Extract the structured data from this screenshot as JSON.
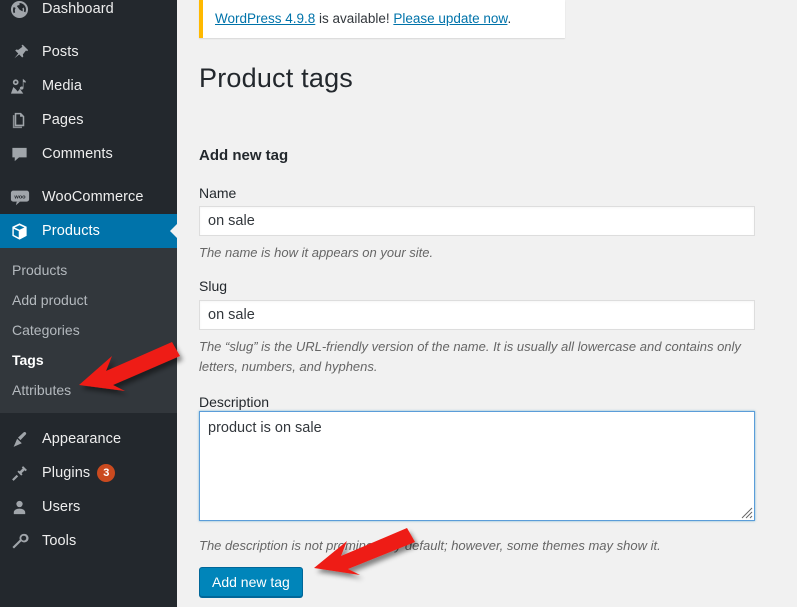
{
  "sidebar": {
    "items": [
      {
        "label": "Dashboard",
        "icon": "dashboard-icon",
        "name": "dashboard"
      },
      {
        "label": "Posts",
        "icon": "pin-icon",
        "name": "posts"
      },
      {
        "label": "Media",
        "icon": "media-icon",
        "name": "media"
      },
      {
        "label": "Pages",
        "icon": "pages-icon",
        "name": "pages"
      },
      {
        "label": "Comments",
        "icon": "comments-icon",
        "name": "comments"
      },
      {
        "label": "WooCommerce",
        "icon": "woocommerce-icon",
        "name": "woocommerce"
      },
      {
        "label": "Products",
        "icon": "products-box-icon",
        "name": "products"
      },
      {
        "label": "Appearance",
        "icon": "brush-icon",
        "name": "appearance"
      },
      {
        "label": "Plugins",
        "icon": "plug-icon",
        "name": "plugins",
        "badge": "3"
      },
      {
        "label": "Users",
        "icon": "user-icon",
        "name": "users"
      },
      {
        "label": "Tools",
        "icon": "wrench-icon",
        "name": "tools"
      }
    ],
    "submenu": [
      {
        "label": "Products",
        "name": "products"
      },
      {
        "label": "Add product",
        "name": "add-product"
      },
      {
        "label": "Categories",
        "name": "categories"
      },
      {
        "label": "Tags",
        "name": "tags"
      },
      {
        "label": "Attributes",
        "name": "attributes"
      }
    ],
    "active_item": "Products",
    "active_subitem": "Tags",
    "colors": {
      "background": "#23282d",
      "submenu_background": "#32373c",
      "active": "#0073aa",
      "badge": "#ca4a1f"
    }
  },
  "notice": {
    "link_version": "WordPress 4.9.8",
    "middle_text": " is available! ",
    "link_update": "Please update now",
    "end_text": ".",
    "accent_color": "#ffb900"
  },
  "page": {
    "title": "Product tags",
    "form_heading": "Add new tag"
  },
  "form": {
    "name_label": "Name",
    "name_value": "on sale",
    "name_help": "The name is how it appears on your site.",
    "slug_label": "Slug",
    "slug_value": "on sale",
    "slug_help": "The “slug” is the URL-friendly version of the name. It is usually all lowercase and contains only letters, numbers, and hyphens.",
    "description_label": "Description",
    "description_value": "product is on sale",
    "description_help": "The description is not prominent by default; however, some themes may show it.",
    "submit_label": "Add new tag",
    "submit_color": "#0085ba"
  },
  "annotations": {
    "arrow_color": "#ee1c13",
    "arrow_tags_target": "Tags",
    "arrow_button_target": "Add new tag"
  }
}
